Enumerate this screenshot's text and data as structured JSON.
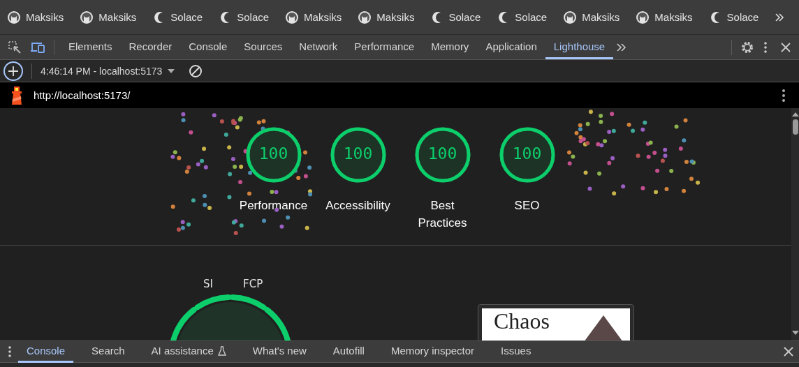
{
  "bookmarks": [
    {
      "label": "Maksiks",
      "kind": "cat"
    },
    {
      "label": "Maksiks",
      "kind": "cat"
    },
    {
      "label": "Solace",
      "kind": "moon"
    },
    {
      "label": "Solace",
      "kind": "moon"
    },
    {
      "label": "Maksiks",
      "kind": "cat"
    },
    {
      "label": "Maksiks",
      "kind": "cat"
    },
    {
      "label": "Solace",
      "kind": "moon"
    },
    {
      "label": "Solace",
      "kind": "moon"
    },
    {
      "label": "Maksiks",
      "kind": "cat"
    },
    {
      "label": "Maksiks",
      "kind": "cat"
    },
    {
      "label": "Solace",
      "kind": "moon"
    }
  ],
  "panel_tabs": [
    {
      "label": "Elements",
      "selected": false
    },
    {
      "label": "Recorder",
      "selected": false
    },
    {
      "label": "Console",
      "selected": false
    },
    {
      "label": "Sources",
      "selected": false
    },
    {
      "label": "Network",
      "selected": false
    },
    {
      "label": "Performance",
      "selected": false
    },
    {
      "label": "Memory",
      "selected": false
    },
    {
      "label": "Application",
      "selected": false
    },
    {
      "label": "Lighthouse",
      "selected": true
    }
  ],
  "toolbar": {
    "report": "4:46:14 PM - localhost:5173"
  },
  "url_bar": {
    "url": "http://localhost:5173/"
  },
  "scores": [
    {
      "value": "100",
      "label": "Performance",
      "level": 1
    },
    {
      "value": "100",
      "label": "Accessibility",
      "level": 1
    },
    {
      "value": "100",
      "label": "Best Practices",
      "level": 1
    },
    {
      "value": "100",
      "label": "SEO",
      "level": 1
    }
  ],
  "metrics_gauge": {
    "labels": [
      "SI",
      "FCP"
    ]
  },
  "screenshot": {
    "title": "Chaos"
  },
  "drawer_tabs": [
    {
      "label": "Console",
      "selected": true
    },
    {
      "label": "Search",
      "selected": false
    },
    {
      "label": "AI assistance",
      "selected": false
    },
    {
      "label": "What's new",
      "selected": false
    },
    {
      "label": "Autofill",
      "selected": false
    },
    {
      "label": "Memory inspector",
      "selected": false
    },
    {
      "label": "Issues",
      "selected": false
    }
  ]
}
